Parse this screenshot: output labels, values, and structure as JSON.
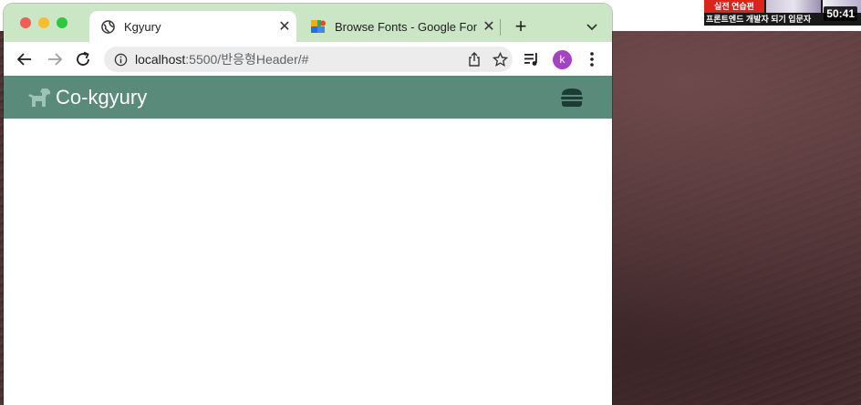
{
  "desktop": {
    "video": {
      "badge": "실전 연습편",
      "caption": "프론트엔드 개발자 되기 입문자",
      "time": "50:41"
    }
  },
  "browser": {
    "tabs": [
      {
        "title": "Kgyury",
        "active": true,
        "favicon": "globe-icon"
      },
      {
        "title": "Browse Fonts - Google Fonts",
        "active": false,
        "favicon": "google-fonts-icon"
      }
    ],
    "address": {
      "host": "localhost",
      "path": ":5500/반응형Header/#"
    },
    "profile_initial": "k"
  },
  "site": {
    "logo_text": "Co-kgyury",
    "header_color": "#5a8a7a",
    "icons": {
      "logo": "dog-icon",
      "menu": "hamburger-icon"
    }
  }
}
